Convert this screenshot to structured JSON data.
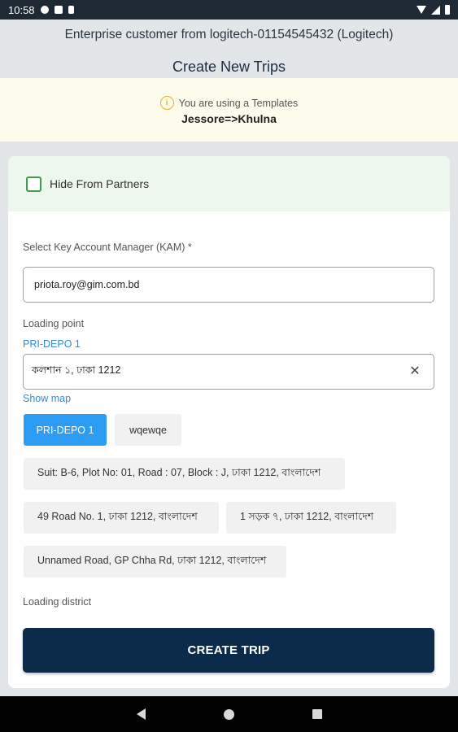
{
  "status_bar": {
    "time": "10:58"
  },
  "header": {
    "customer": "Enterprise customer from logitech-01154545432 (Logitech)",
    "title": "Create New Trips"
  },
  "template_banner": {
    "message": "You are using a Templates",
    "route": "Jessore=>Khulna",
    "icon": "info-icon",
    "accent_color": "#e2b42b"
  },
  "form": {
    "hide_from_partners": {
      "label": "Hide From Partners",
      "checked": false
    },
    "kam": {
      "label": "Select Key Account Manager (KAM) *",
      "value": "priota.roy@gim.com.bd"
    },
    "loading_point": {
      "label": "Loading point",
      "selected_name": "PRI-DEPO 1",
      "address_value": "কলশান ১, ঢাকা 1212",
      "show_map": "Show map"
    },
    "chips": [
      {
        "label": "PRI-DEPO 1",
        "selected": true
      },
      {
        "label": "wqewqe",
        "selected": false
      },
      {
        "label": "Suit: B-6, Plot No: 01, Road : 07, Block : J, ঢাকা 1212, বাংলাদেশ",
        "selected": false
      },
      {
        "label": "49 Road No. 1, ঢাকা 1212, বাংলাদেশ",
        "selected": false
      },
      {
        "label": "1 সড়ক ৭, ঢাকা 1212, বাংলাদেশ",
        "selected": false
      },
      {
        "label": "Unnamed Road, GP Chha Rd, ঢাকা 1212, বাংলাদেশ",
        "selected": false
      }
    ],
    "loading_district": {
      "label": "Loading district"
    }
  },
  "actions": {
    "create_trip": "CREATE TRIP"
  },
  "colors": {
    "primary_button": "#0c2b4b",
    "chip_selected": "#2d9cf3",
    "link": "#2f8be0",
    "checkbox": "#3f9a4c"
  }
}
